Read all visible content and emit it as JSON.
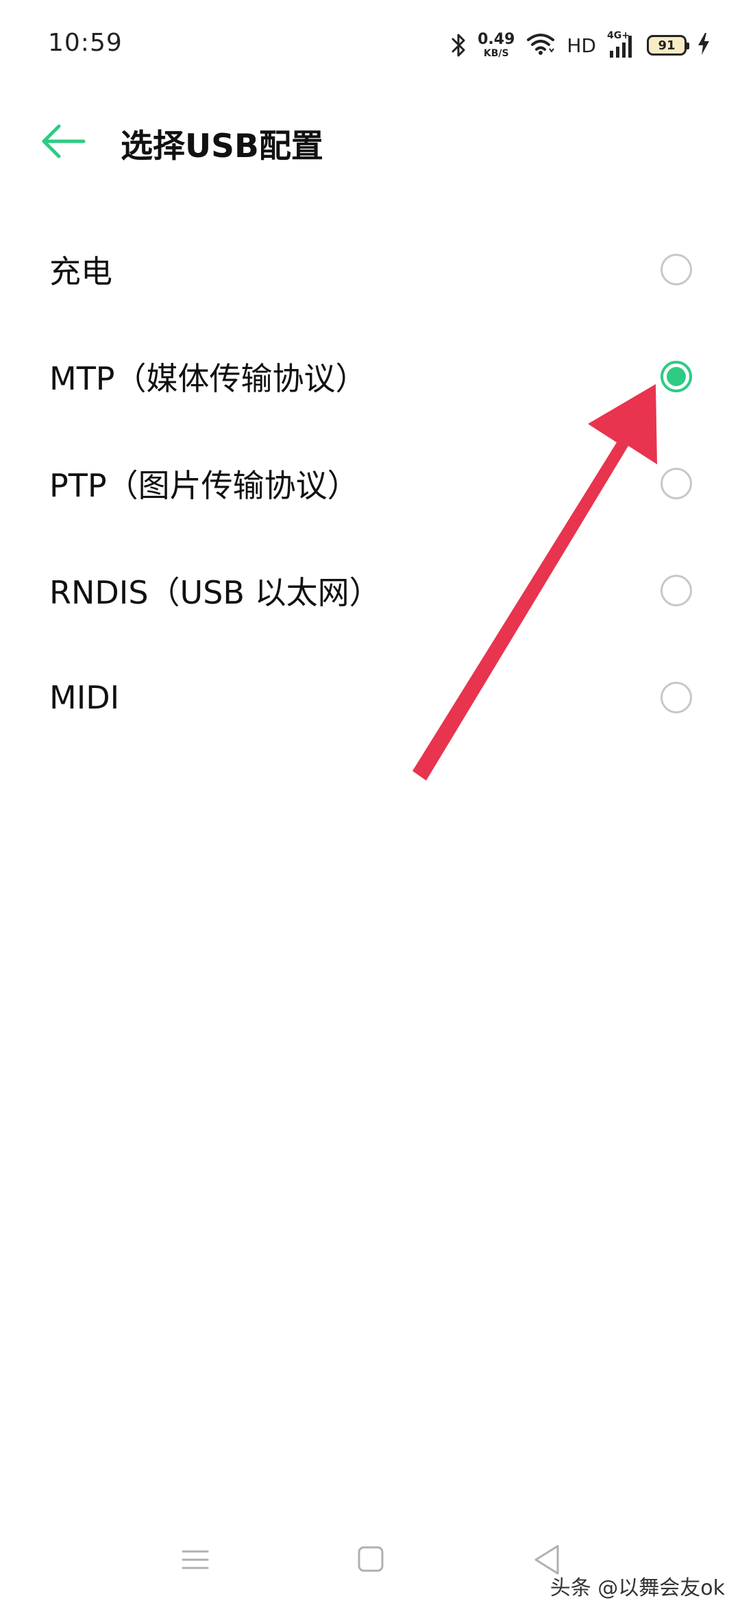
{
  "status_bar": {
    "time": "10:59",
    "net_speed_value": "0.49",
    "net_speed_unit": "KB/S",
    "hd": "HD",
    "network_type": "4G+",
    "battery_level": "91",
    "icons": [
      "bluetooth-icon",
      "wifi-icon",
      "signal-icon",
      "battery-icon",
      "charging-icon"
    ]
  },
  "header": {
    "title": "选择USB配置",
    "back_icon": "arrow-left-icon",
    "accent_color": "#2ecb84"
  },
  "options": [
    {
      "label": "充电",
      "selected": false
    },
    {
      "label": "MTP（媒体传输协议）",
      "selected": true
    },
    {
      "label": "PTP（图片传输协议）",
      "selected": false
    },
    {
      "label": "RNDIS（USB 以太网）",
      "selected": false
    },
    {
      "label": "MIDI",
      "selected": false
    }
  ],
  "annotation": {
    "arrow_color": "#e8344e"
  },
  "nav_bar": {
    "icons": [
      "menu-icon",
      "home-icon",
      "back-triangle-icon"
    ]
  },
  "watermark": "头条 @以舞会友ok"
}
